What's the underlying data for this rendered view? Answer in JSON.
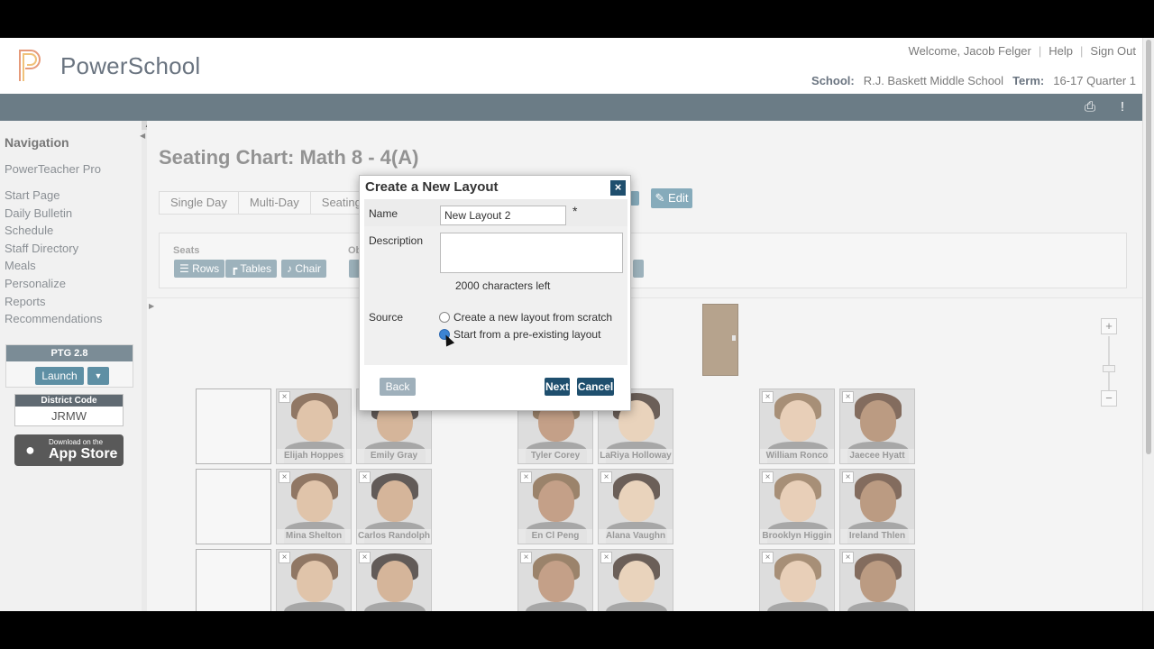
{
  "header": {
    "brand": "PowerSchool",
    "welcome": "Welcome, Jacob Felger",
    "help": "Help",
    "signout": "Sign Out",
    "school_label": "School:",
    "school": "R.J. Baskett Middle School",
    "term_label": "Term:",
    "term": "16-17 Quarter 1",
    "icons": [
      "printer-icon",
      "alert-icon"
    ]
  },
  "sidebar": {
    "title": "Navigation",
    "pro": "PowerTeacher Pro",
    "items": [
      {
        "label": "Start Page"
      },
      {
        "label": "Daily Bulletin"
      },
      {
        "label": "Schedule"
      },
      {
        "label": "Staff Directory"
      },
      {
        "label": "Meals"
      },
      {
        "label": "Personalize"
      },
      {
        "label": "Reports"
      },
      {
        "label": "Recommendations"
      }
    ],
    "ptg": "PTG 2.8",
    "launch": "Launch",
    "district_code_label": "District Code",
    "district_code": "JRMW",
    "appstore_small": "Download on the",
    "appstore_big": "App Store"
  },
  "main": {
    "title": "Seating Chart: Math 8 - 4(A)",
    "tabs": [
      {
        "label": "Single Day"
      },
      {
        "label": "Multi-Day"
      },
      {
        "label": "Seating"
      }
    ],
    "edit": "Edit",
    "seats_label": "Seats",
    "objects_label": "Ob",
    "tools": [
      {
        "label": "Rows"
      },
      {
        "label": "Tables"
      },
      {
        "label": "Chair"
      }
    ]
  },
  "seats": [
    {
      "name": ""
    },
    {
      "name": "Elijah Hoppes"
    },
    {
      "name": "Emily Gray"
    },
    {
      "name": "Tyler Corey"
    },
    {
      "name": "LaRiya Holloway"
    },
    {
      "name": "William Ronco"
    },
    {
      "name": "Jaecee Hyatt"
    },
    {
      "name": ""
    },
    {
      "name": "Mina Shelton"
    },
    {
      "name": "Carlos Randolph"
    },
    {
      "name": "En Cl Peng"
    },
    {
      "name": "Alana Vaughn"
    },
    {
      "name": "Brooklyn Higgin"
    },
    {
      "name": "Ireland Thlen"
    },
    {
      "name": ""
    },
    {
      "name": ""
    },
    {
      "name": ""
    },
    {
      "name": ""
    },
    {
      "name": ""
    },
    {
      "name": ""
    },
    {
      "name": ""
    }
  ],
  "dialog": {
    "title": "Create a New Layout",
    "name_label": "Name",
    "name_value": "New Layout 2",
    "required": "*",
    "description_label": "Description",
    "description_value": "",
    "chars_left": "2000 characters left",
    "source_label": "Source",
    "option_scratch": "Create a new layout from scratch",
    "option_existing": "Start from a pre-existing layout",
    "back": "Back",
    "next": "Next",
    "cancel": "Cancel"
  },
  "colors": {
    "accent": "#5e8fa4",
    "dialog_button": "#1f4f6e",
    "header_bar": "#6b7c86"
  }
}
